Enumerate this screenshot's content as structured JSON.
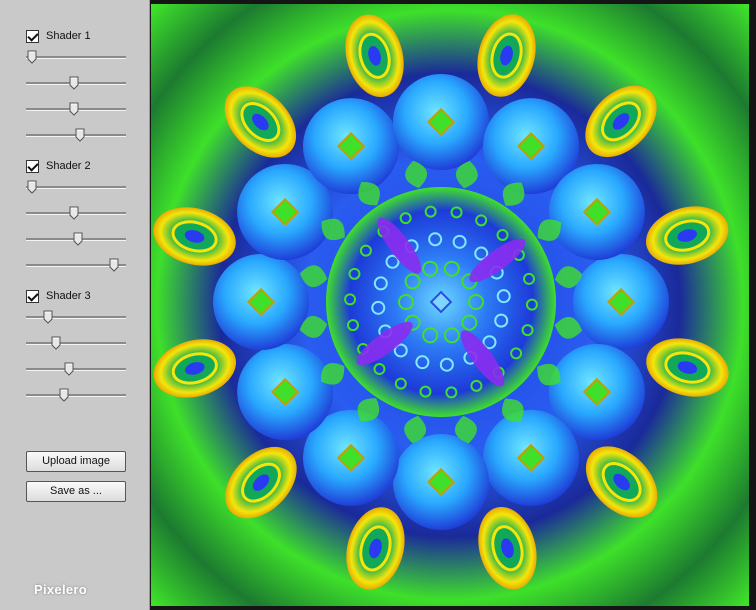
{
  "sidebar": {
    "groups": [
      {
        "label": "Shader 1",
        "checked": true,
        "sliders": [
          0.06,
          0.48,
          0.48,
          0.54
        ]
      },
      {
        "label": "Shader 2",
        "checked": true,
        "sliders": [
          0.06,
          0.48,
          0.52,
          0.88
        ]
      },
      {
        "label": "Shader 3",
        "checked": true,
        "sliders": [
          0.22,
          0.3,
          0.43,
          0.38
        ]
      }
    ],
    "upload_label": "Upload image",
    "save_label": "Save as ...",
    "logo": "Pixelero"
  },
  "colors": {
    "panel": "#c9c9c9",
    "accent_blue": "#2a5cf0",
    "accent_green": "#3ee02a",
    "accent_yellow": "#f5e40a",
    "accent_violet": "#8a2cf0"
  }
}
